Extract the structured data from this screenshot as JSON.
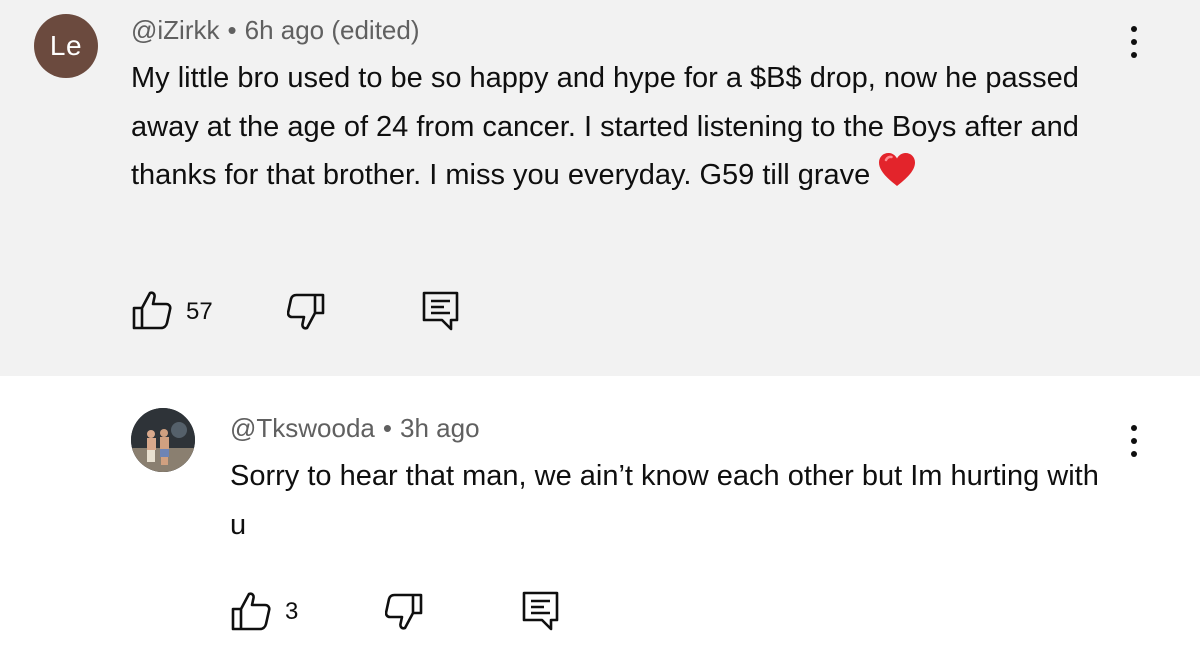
{
  "comments": [
    {
      "avatar_initials": "Le",
      "avatar_color": "#6b4a3e",
      "author": "@iZirkk",
      "separator": "•",
      "time": "6h ago (edited)",
      "text": "My little bro used to be so happy and hype for a $B$ drop, now he passed away at the age of 24 from cancer. I started listening to the Boys after and thanks for that brother. I miss you everyday. G59 till grave",
      "emoji_icon": "heart-icon",
      "likes": "57"
    }
  ],
  "replies": [
    {
      "avatar_icon": "profile-photo",
      "author": "@Tkswooda",
      "separator": "•",
      "time": "3h ago",
      "text": "Sorry to hear that man, we ain’t know each other but Im hurting with u",
      "likes": "3"
    }
  ],
  "icons": {
    "like": "thumbs-up-icon",
    "dislike": "thumbs-down-icon",
    "reply": "reply-comment-icon",
    "more": "more-vertical-icon"
  },
  "colors": {
    "top_comment_background": "#f2f2f2",
    "meta_text": "#606060",
    "heart": "#e3242b"
  }
}
